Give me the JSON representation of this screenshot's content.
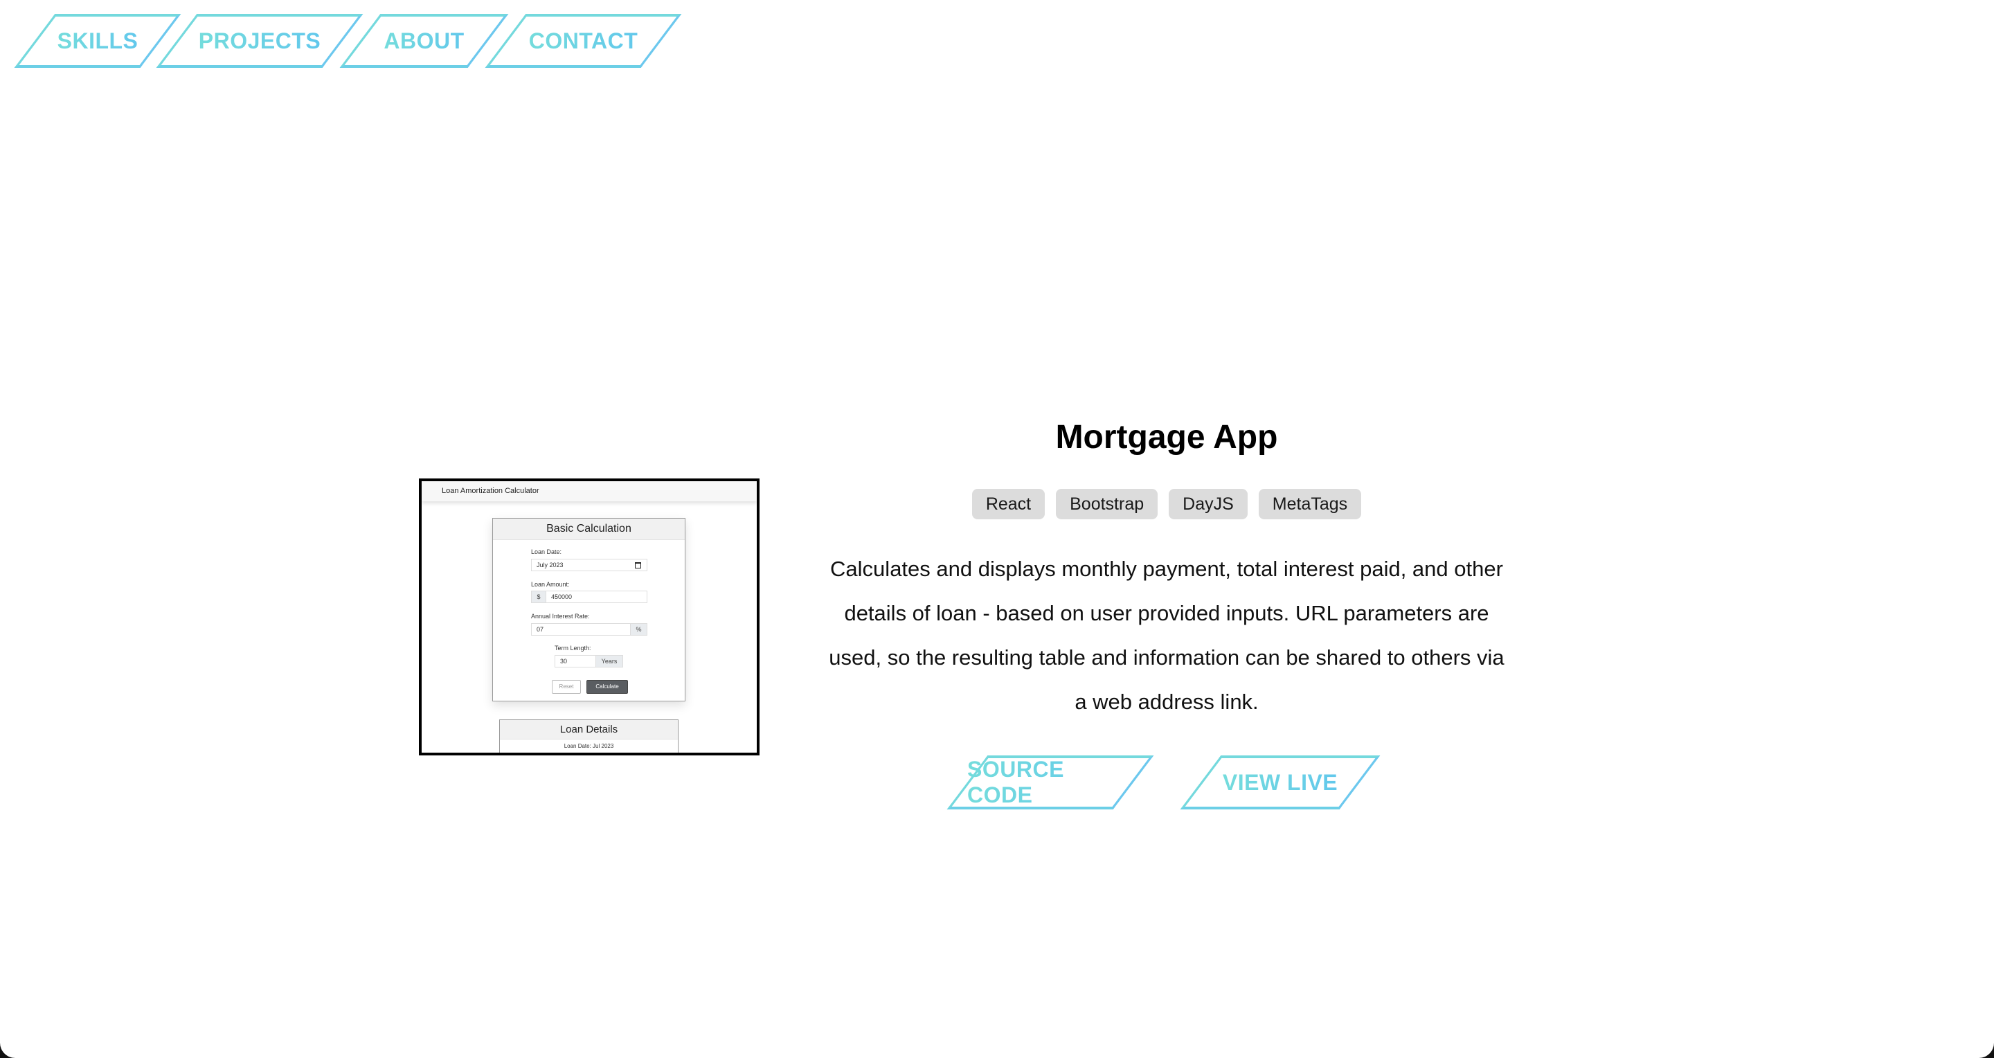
{
  "nav": {
    "items": [
      {
        "label": "SKILLS"
      },
      {
        "label": "PROJECTS"
      },
      {
        "label": "ABOUT"
      },
      {
        "label": "CONTACT"
      }
    ]
  },
  "social": {
    "linkedin": "linkedin-icon",
    "github": "github-icon",
    "resume": "pdf-icon"
  },
  "colors": {
    "accent": "#74d9dd",
    "accent_end": "#62c8ec",
    "tag_bg": "#dcdcdc",
    "text": "#000000"
  },
  "project": {
    "title": "Mortgage App",
    "tags": [
      "React",
      "Bootstrap",
      "DayJS",
      "MetaTags"
    ],
    "description": "Calculates and displays monthly payment, total interest paid, and other details of loan - based on user provided inputs. URL parameters are used, so the resulting table and information can be shared to others via a web address link.",
    "source_label": "SOURCE CODE",
    "live_label": "VIEW LIVE",
    "preview": {
      "app_title": "Loan Amortization Calculator",
      "card_title": "Basic Calculation",
      "loan_date_label": "Loan Date:",
      "loan_date_value": "July 2023",
      "loan_amount_label": "Loan Amount:",
      "currency_symbol": "$",
      "loan_amount_value": "450000",
      "rate_label": "Annual Interest Rate:",
      "rate_value": "07",
      "percent_symbol": "%",
      "term_label": "Term Length:",
      "term_value": "30",
      "term_unit": "Years",
      "reset_label": "Reset",
      "calculate_label": "Calculate",
      "details_title": "Loan Details",
      "details_line": "Loan Date: Jul 2023"
    }
  }
}
